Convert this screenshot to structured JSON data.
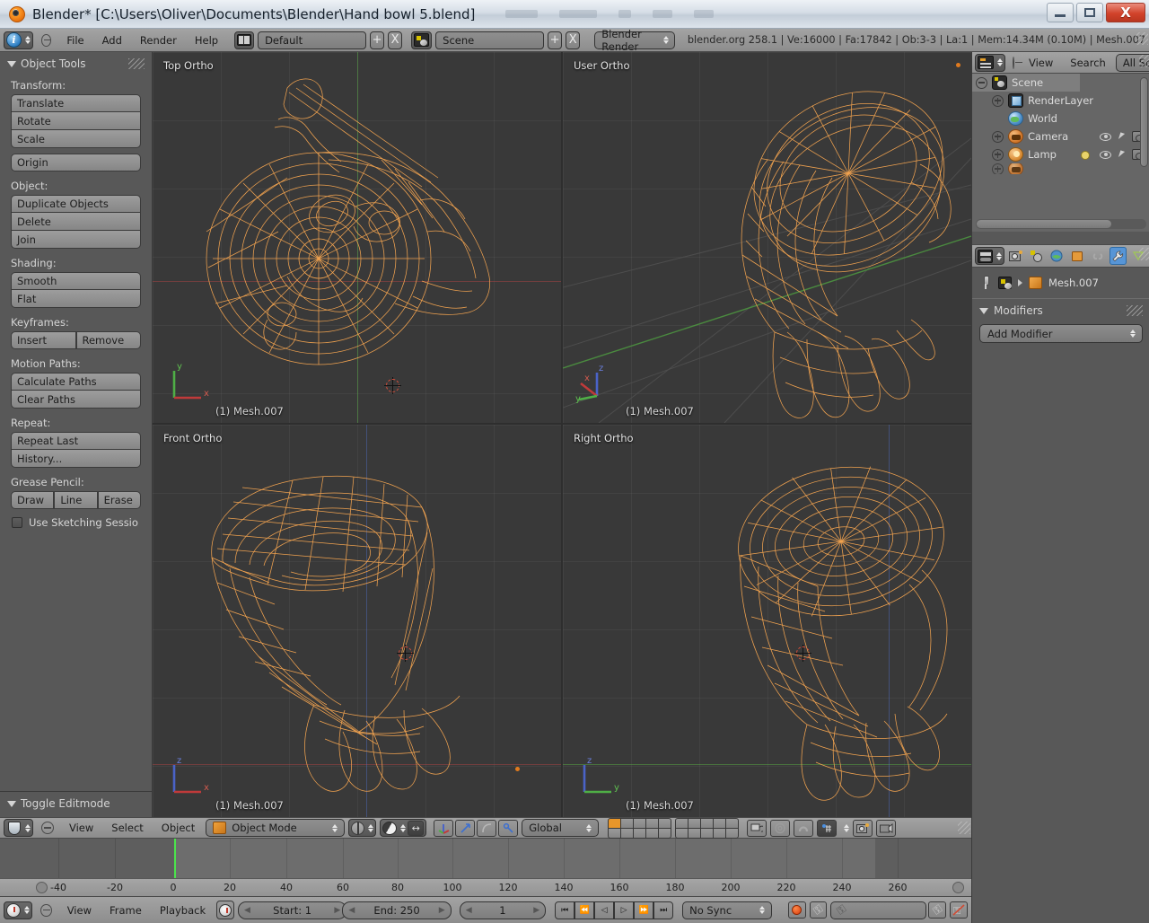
{
  "window": {
    "title": "Blender* [C:\\Users\\Oliver\\Documents\\Blender\\Hand bowl 5.blend]",
    "minimize_label": "Minimize",
    "maximize_label": "Maximize",
    "close_label": "X"
  },
  "topbar": {
    "menus": [
      "File",
      "Add",
      "Render",
      "Help"
    ],
    "screen_layout": "Default",
    "scene_name": "Scene",
    "engine": "Blender Render",
    "status": "blender.org 258.1 | Ve:16000 | Fa:17842 | Ob:3-3 | La:1 | Mem:14.34M (0.10M) | Mesh.007",
    "add_label": "+",
    "remove_label": "X"
  },
  "toolshelf": {
    "panel_title": "Object Tools",
    "groups": [
      {
        "label": "Transform:",
        "buttons": [
          "Translate",
          "Rotate",
          "Scale"
        ]
      },
      {
        "label": "",
        "buttons": [
          "Origin"
        ]
      },
      {
        "label": "Object:",
        "buttons": [
          "Duplicate Objects",
          "Delete",
          "Join"
        ]
      },
      {
        "label": "Shading:",
        "buttons": [
          "Smooth",
          "Flat"
        ]
      },
      {
        "label": "Keyframes:",
        "row": [
          "Insert",
          "Remove"
        ]
      },
      {
        "label": "Motion Paths:",
        "buttons": [
          "Calculate Paths",
          "Clear Paths"
        ]
      },
      {
        "label": "Repeat:",
        "buttons": [
          "Repeat Last",
          "History..."
        ]
      },
      {
        "label": "Grease Pencil:",
        "row": [
          "Draw",
          "Line",
          "Erase"
        ]
      }
    ],
    "checkbox_label": "Use Sketching Sessio",
    "bottom_panel": "Toggle Editmode"
  },
  "viewports": [
    {
      "name": "Top Ortho",
      "object": "(1) Mesh.007",
      "axes": [
        "y",
        "x"
      ]
    },
    {
      "name": "User Ortho",
      "object": "(1) Mesh.007",
      "axes": [
        "x",
        "y",
        "z"
      ]
    },
    {
      "name": "Front Ortho",
      "object": "(1) Mesh.007",
      "axes": [
        "z",
        "x"
      ]
    },
    {
      "name": "Right Ortho",
      "object": "(1) Mesh.007",
      "axes": [
        "z",
        "y"
      ]
    }
  ],
  "view3d_header": {
    "menus": [
      "View",
      "Select",
      "Object"
    ],
    "mode": "Object Mode",
    "transform_orientation": "Global"
  },
  "outliner": {
    "menus": [
      "View",
      "Search"
    ],
    "display_mode": "All Sce",
    "rows": [
      {
        "label": "Scene",
        "icon": "scene-icon",
        "indent": 0,
        "expander": "minus",
        "selected": true
      },
      {
        "label": "RenderLayer",
        "icon": "renderlayer-icon",
        "indent": 1,
        "expander": "plus",
        "selected": false
      },
      {
        "label": "World",
        "icon": "world-icon",
        "indent": 1,
        "expander": "none",
        "selected": false
      },
      {
        "label": "Camera",
        "icon": "camera-icon",
        "indent": 1,
        "expander": "plus",
        "selected": false
      },
      {
        "label": "Lamp",
        "icon": "lamp-icon",
        "indent": 1,
        "expander": "plus",
        "selected": false
      }
    ]
  },
  "properties": {
    "tabs": [
      "render-tab",
      "scene-tab",
      "world-tab",
      "object-tab",
      "constraints-tab",
      "modifiers-tab",
      "data-tab"
    ],
    "active_tab": "modifiers-tab",
    "breadcrumb": "Mesh.007",
    "panel_title": "Modifiers",
    "add_modifier": "Add Modifier"
  },
  "timeline": {
    "menus": [
      "View",
      "Frame",
      "Playback"
    ],
    "start_label": "Start: 1",
    "end_label": "End: 250",
    "current_frame": "1",
    "sync_mode": "No Sync",
    "ruler_ticks": [
      -40,
      -20,
      0,
      20,
      40,
      60,
      80,
      100,
      120,
      140,
      160,
      180,
      200,
      220,
      240,
      260
    ],
    "playhead_frame": 1,
    "transport": [
      "jump-start",
      "prev-keyframe",
      "play-reverse",
      "play",
      "next-keyframe",
      "jump-end"
    ]
  },
  "colors": {
    "viewport_bg": "#393939",
    "mesh_wire": "#FAA851",
    "header_gray": "#999999",
    "panel_gray": "#585858",
    "accent_blue": "#5795d6",
    "axis_x": "#c03a3a",
    "axis_y": "#4faf46",
    "axis_z": "#4a63c8",
    "playhead_green": "#4ce34c"
  }
}
